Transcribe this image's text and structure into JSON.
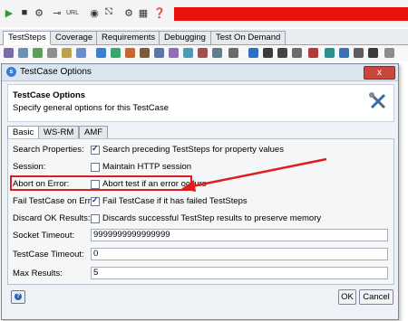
{
  "tabs": [
    "TestSteps",
    "Coverage",
    "Requirements",
    "Debugging",
    "Test On Demand"
  ],
  "toolbar": {
    "url_label": "URL"
  },
  "dialog": {
    "title": "TestCase Options",
    "close_glyph": "x",
    "header_title": "TestCase Options",
    "header_subtitle": "Specify general options for this TestCase",
    "inner_tabs": [
      "Basic",
      "WS-RM",
      "AMF"
    ],
    "rows": {
      "search_label": "Search Properties:",
      "search_text": "Search preceding TestSteps for property values",
      "session_label": "Session:",
      "session_text": "Maintain HTTP session",
      "abort_label": "Abort on Error:",
      "abort_text": "Abort test if an error occurs",
      "fail_label": "Fail TestCase on Error:",
      "fail_text": "Fail TestCase if it has failed TestSteps",
      "discard_label": "Discard OK Results:",
      "discard_text": "Discards successful TestStep results to preserve memory",
      "socket_label": "Socket Timeout:",
      "socket_value": "9999999999999999",
      "timeout_label": "TestCase Timeout:",
      "timeout_value": "0",
      "max_label": "Max Results:",
      "max_value": "5"
    },
    "help_glyph": "?",
    "ok_label": "OK",
    "cancel_label": "Cancel"
  },
  "colors": {
    "annotation": "#e01c1c",
    "redbar": "#e8140c"
  }
}
